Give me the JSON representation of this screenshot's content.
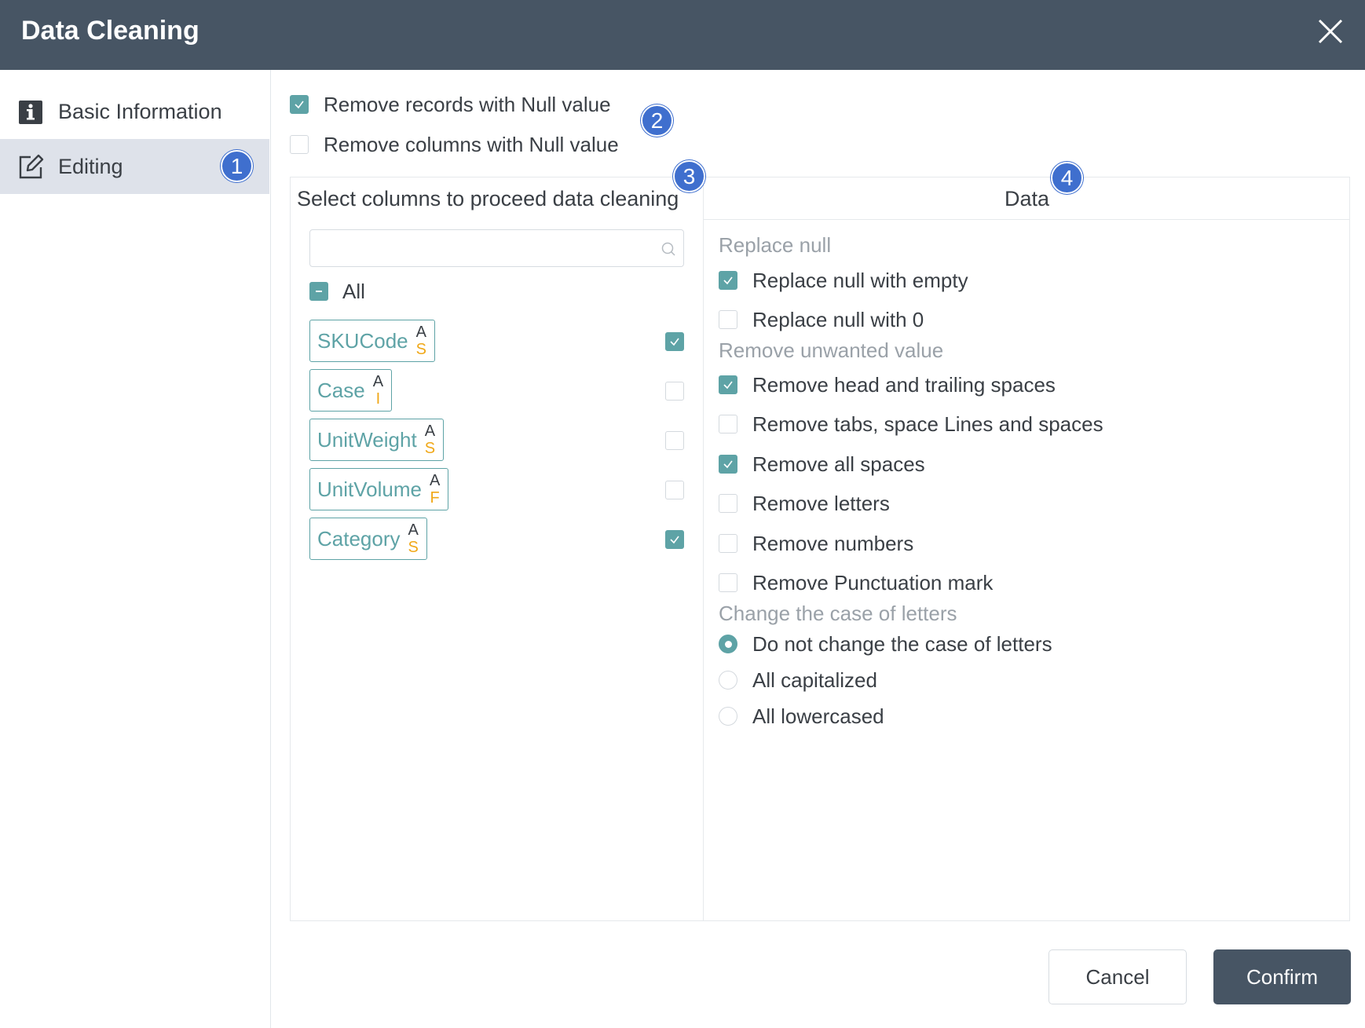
{
  "dialog": {
    "title": "Data Cleaning",
    "close_icon": "close-icon"
  },
  "sidebar": {
    "items": [
      {
        "label": "Basic Information",
        "icon": "info-icon",
        "active": false
      },
      {
        "label": "Editing",
        "icon": "edit-icon",
        "active": true
      }
    ]
  },
  "badges": [
    "1",
    "2",
    "3",
    "4"
  ],
  "top_options": [
    {
      "label": "Remove records with Null value",
      "checked": true
    },
    {
      "label": "Remove columns with Null value",
      "checked": false
    }
  ],
  "columns_panel": {
    "title": "Select columns to proceed data cleaning",
    "search_placeholder": "",
    "all_label": "All",
    "all_state": "partial",
    "fields": [
      {
        "name": "SKUCode",
        "type_top": "A",
        "type_bottom": "S",
        "checked": true
      },
      {
        "name": "Case",
        "type_top": "A",
        "type_bottom": "I",
        "checked": false
      },
      {
        "name": "UnitWeight",
        "type_top": "A",
        "type_bottom": "S",
        "checked": false
      },
      {
        "name": "UnitVolume",
        "type_top": "A",
        "type_bottom": "F",
        "checked": false
      },
      {
        "name": "Category",
        "type_top": "A",
        "type_bottom": "S",
        "checked": true
      }
    ]
  },
  "data_panel": {
    "title": "Data",
    "sections": {
      "replace_null": "Replace null",
      "remove_unwanted": "Remove unwanted value",
      "change_case": "Change the case of letters"
    },
    "replace_null_options": [
      {
        "label": "Replace null with empty",
        "checked": true
      },
      {
        "label": "Replace null with 0",
        "checked": false
      }
    ],
    "remove_options": [
      {
        "label": "Remove head and trailing spaces",
        "checked": true
      },
      {
        "label": "Remove tabs, space Lines and spaces",
        "checked": false
      },
      {
        "label": "Remove all spaces",
        "checked": true
      },
      {
        "label": "Remove letters",
        "checked": false
      },
      {
        "label": "Remove numbers",
        "checked": false
      },
      {
        "label": "Remove Punctuation mark",
        "checked": false
      }
    ],
    "case_options": [
      {
        "label": "Do not change the case of letters",
        "selected": true
      },
      {
        "label": "All capitalized",
        "selected": false
      },
      {
        "label": "All lowercased",
        "selected": false
      }
    ]
  },
  "footer": {
    "cancel_label": "Cancel",
    "confirm_label": "Confirm"
  },
  "colors": {
    "header_bg": "#475564",
    "accent": "#5ea3a6",
    "badge": "#3f6fce",
    "type_letter": "#f0a818"
  }
}
